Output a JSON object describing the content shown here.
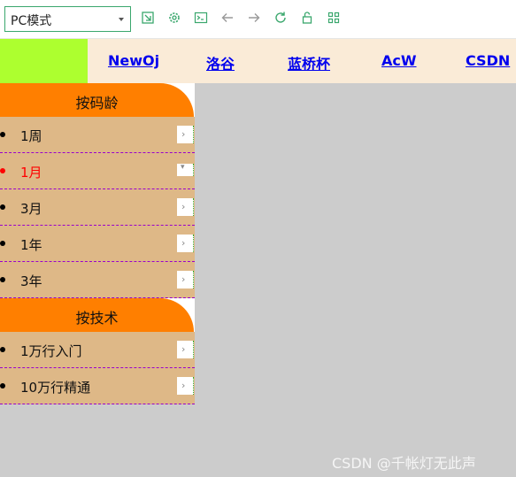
{
  "toolbar": {
    "mode_select": "PC模式",
    "icons": [
      "external-window-icon",
      "gear-icon",
      "terminal-icon",
      "back-arrow-icon",
      "forward-arrow-icon",
      "refresh-icon",
      "lock-icon",
      "grid-icon"
    ]
  },
  "nav": {
    "links": [
      "NewOj",
      "洛谷",
      "蓝桥杯",
      "AcW",
      "CSDN"
    ]
  },
  "sidebar": {
    "groups": [
      {
        "title": "按码龄",
        "items": [
          {
            "label": "1周",
            "arrow": "›"
          },
          {
            "label": "1月",
            "arrow": "▾"
          },
          {
            "label": "3月",
            "arrow": "›"
          },
          {
            "label": "1年",
            "arrow": "›"
          },
          {
            "label": "3年",
            "arrow": "›"
          }
        ]
      },
      {
        "title": "按技术",
        "items": [
          {
            "label": "1万行入门",
            "arrow": "›"
          },
          {
            "label": "10万行精通",
            "arrow": "›"
          }
        ]
      }
    ]
  },
  "watermark": "CSDN @千帐灯无此声",
  "colors": {
    "nav_bg": "#faebd7",
    "nav_green": "#adff2f",
    "group_head": "#ff7f00",
    "item_bg": "#deb887",
    "active_text": "#ff0000",
    "page_bg": "#cccccc"
  }
}
